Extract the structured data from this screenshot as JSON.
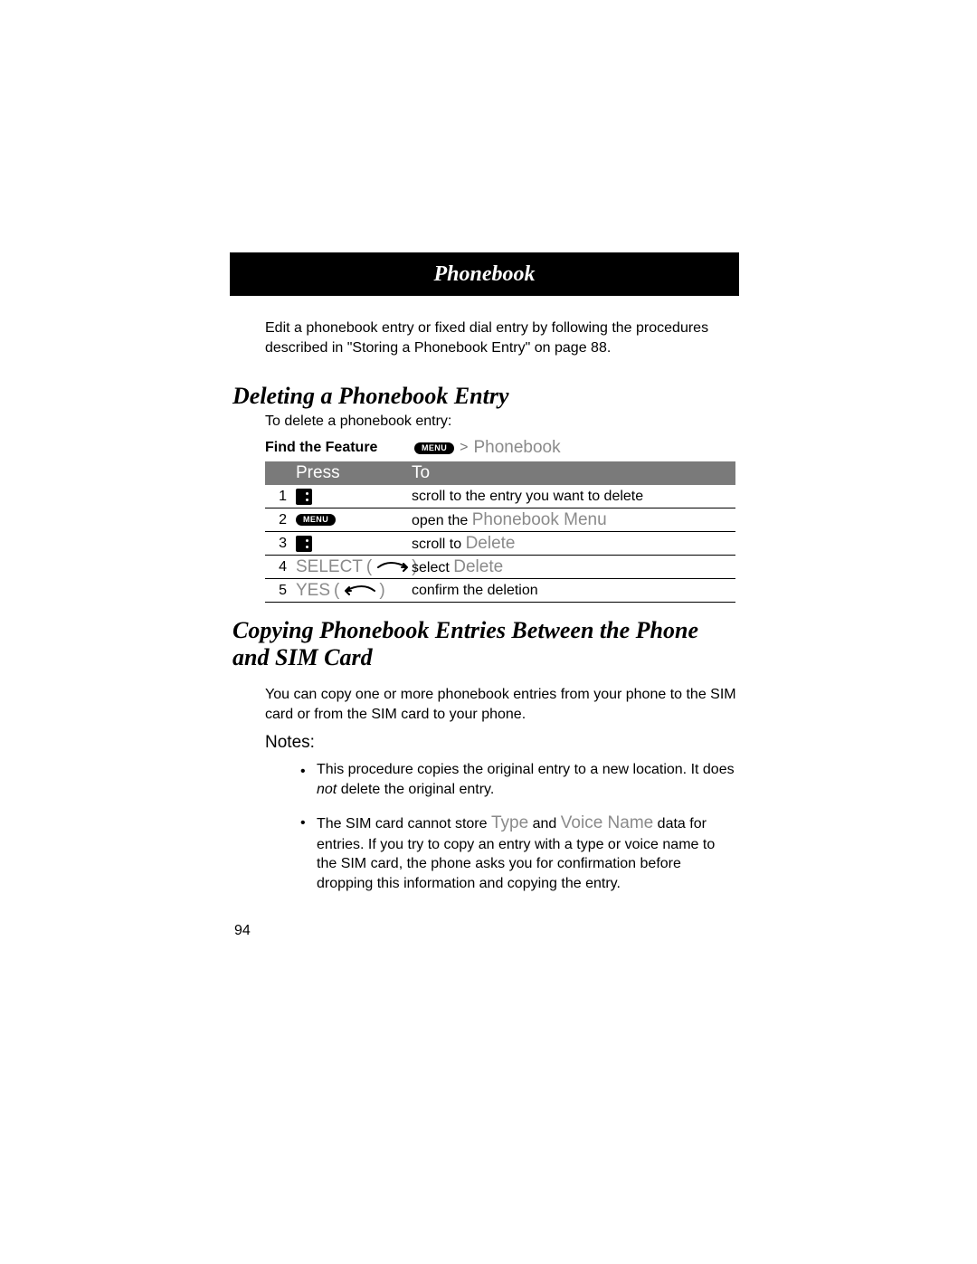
{
  "header": {
    "title": "Phonebook"
  },
  "intro": "Edit a phonebook entry or fixed dial entry by following the procedures described in \"Storing a Phonebook Entry\" on page 88.",
  "section1": {
    "heading": "Deleting a Phonebook Entry",
    "lead": "To delete a phonebook entry:",
    "find_label": "Find the Feature",
    "menu_key": "MENU",
    "gt": ">",
    "phonebook": "Phonebook"
  },
  "table": {
    "head_press": "Press",
    "head_to": "To",
    "rows": [
      {
        "n": "1",
        "press_kind": "dots",
        "to_pre": "scroll to the entry you want to delete",
        "to_term": ""
      },
      {
        "n": "2",
        "press_kind": "menu",
        "to_pre": "open the ",
        "to_term": "Phonebook Menu"
      },
      {
        "n": "3",
        "press_kind": "dots",
        "to_pre": "scroll to ",
        "to_term": "Delete"
      },
      {
        "n": "4",
        "press_kind": "select",
        "press_label": "SELECT",
        "to_pre": "select ",
        "to_term": "Delete"
      },
      {
        "n": "5",
        "press_kind": "yes",
        "press_label": "YES",
        "to_pre": "confirm the deletion",
        "to_term": ""
      }
    ]
  },
  "section2": {
    "heading": "Copying Phonebook Entries Between the Phone and SIM Card",
    "intro": "You can copy one or more phonebook entries from your phone to the SIM card or from the SIM card to your phone.",
    "notes_label": "Notes:",
    "note1_a": "This procedure copies the original entry to a new location. It does ",
    "note1_not": "not",
    "note1_b": " delete the original entry.",
    "note2_a": "The SIM card cannot store ",
    "note2_type": "Type",
    "note2_b": " and ",
    "note2_vn": "Voice Name",
    "note2_c": " data for entries. If you try to copy an entry with a type or voice name to the SIM card, the phone asks you for confirmation before dropping this information and copying the entry."
  },
  "page_number": "94"
}
